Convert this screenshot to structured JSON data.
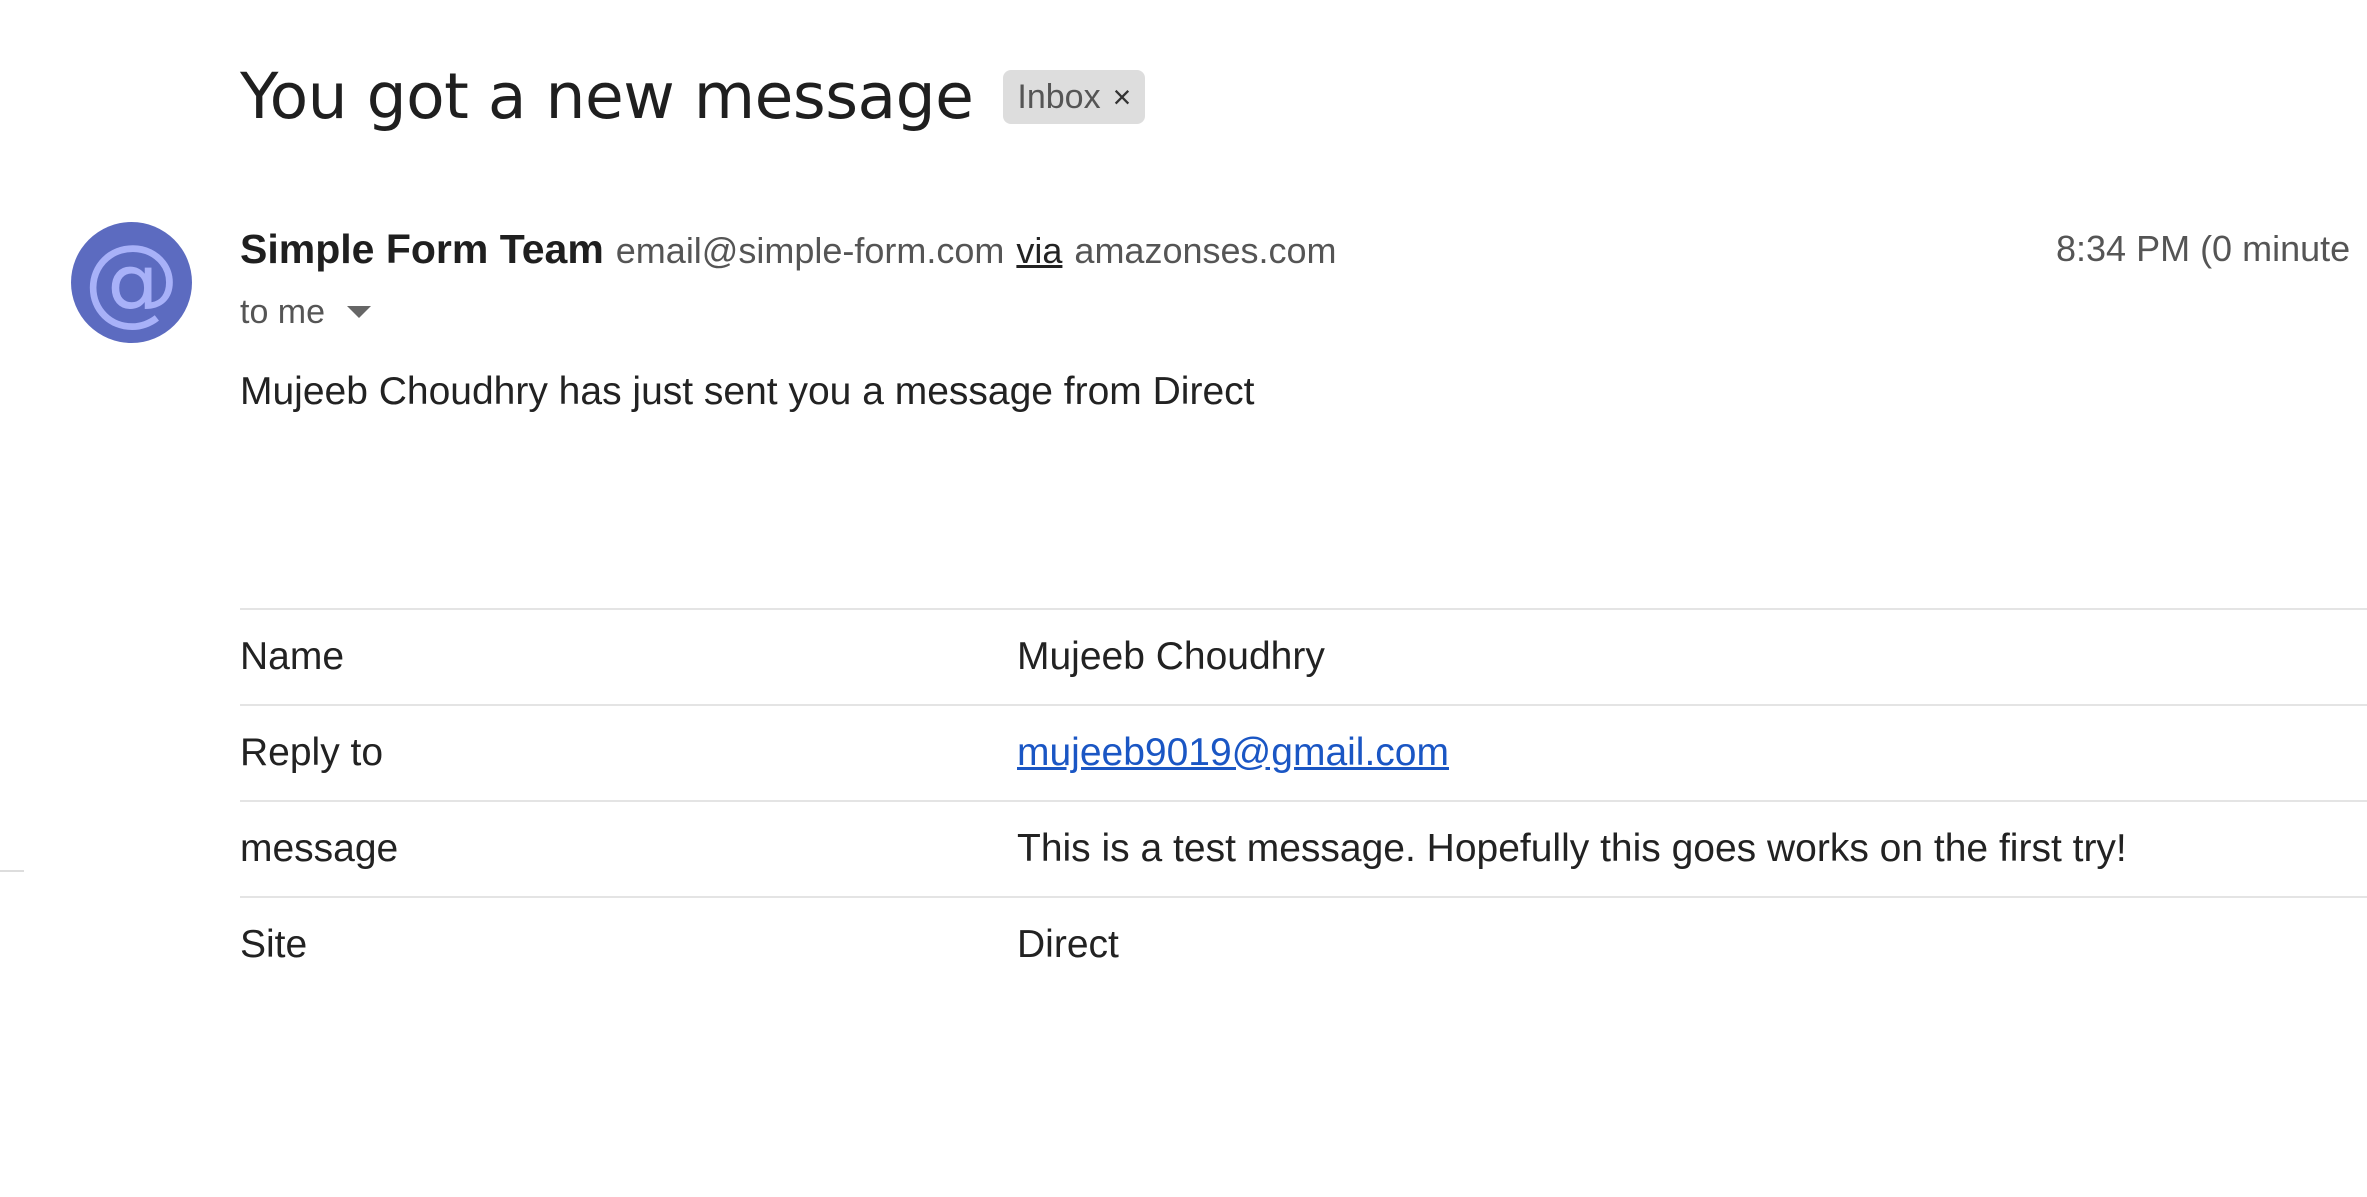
{
  "email": {
    "subject": "You got a new message",
    "label": "Inbox",
    "label_remove_glyph": "×",
    "sender": {
      "name": "Simple Form Team",
      "email": "email@simple-form.com",
      "via_label": "via",
      "via_domain": "amazonses.com",
      "avatar_glyph": "@",
      "avatar_color": "#5c6bc0"
    },
    "timestamp": "8:34 PM (0 minute",
    "recipient_label": "to me",
    "intro": "Mujeeb Choudhry has just sent you a message from Direct",
    "fields": [
      {
        "key": "Name",
        "value": "Mujeeb Choudhry"
      },
      {
        "key": "Reply to",
        "value": "mujeeb9019@gmail.com"
      },
      {
        "key": "message",
        "value": "This is a test message. Hopefully this goes works on the first try!"
      },
      {
        "key": "Site",
        "value": "Direct"
      }
    ],
    "link_color": "#1a56c4"
  }
}
